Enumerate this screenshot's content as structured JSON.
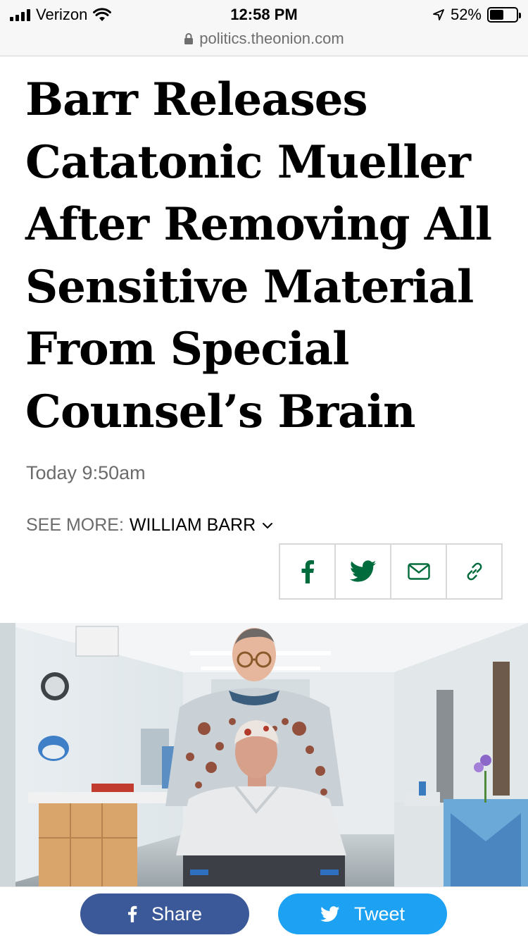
{
  "status_bar": {
    "carrier": "Verizon",
    "time": "12:58 PM",
    "battery_percent": "52%",
    "battery_level": 0.52
  },
  "browser": {
    "url": "politics.theonion.com"
  },
  "article": {
    "headline_lines": [
      "Barr Releases",
      "Catatonic Mueller",
      "After Removing All",
      "Sensitive Material",
      "From Special",
      "Counsel’s Brain"
    ],
    "timestamp": "Today 9:50am",
    "see_more_label": "SEE MORE:",
    "see_more_tag": "WILLIAM BARR"
  },
  "share_icons": [
    "facebook-icon",
    "twitter-icon",
    "email-icon",
    "link-icon"
  ],
  "bottom_bar": {
    "share_label": "Share",
    "tweet_label": "Tweet"
  },
  "colors": {
    "onion_green": "#006b3c",
    "facebook_blue": "#3b5998",
    "twitter_blue": "#1da1f2"
  }
}
